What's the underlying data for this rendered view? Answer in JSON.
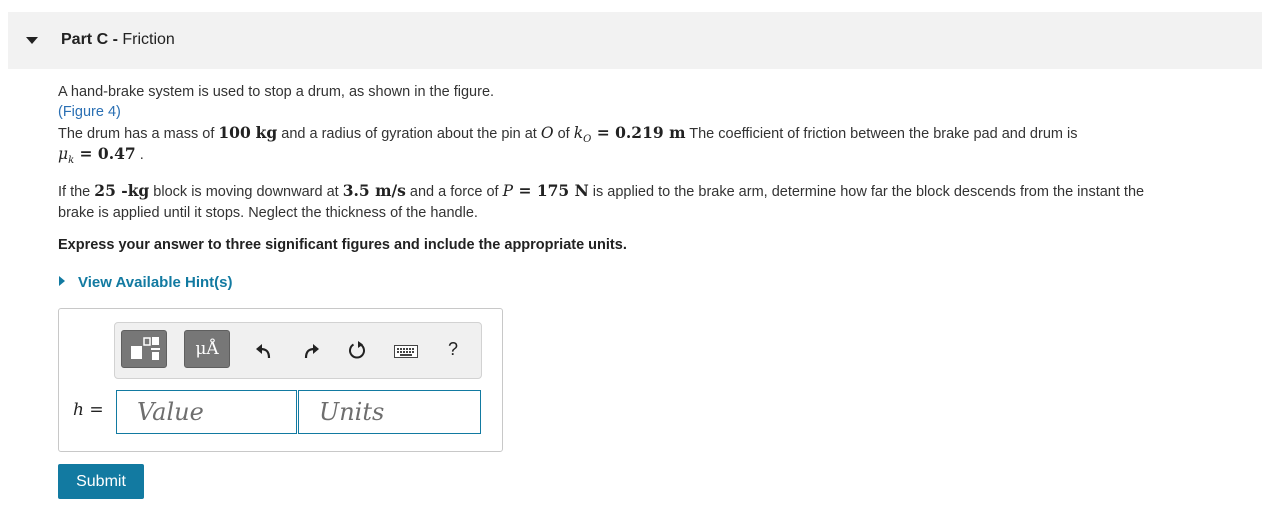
{
  "header": {
    "part_label": "Part C",
    "separator": " - ",
    "part_name": "Friction"
  },
  "problem": {
    "intro": "A hand-brake system is used to stop a drum, as shown in the figure.",
    "figure_link": "(Figure 4)",
    "line3_pre": "The drum has a mass of ",
    "mass_value": "100",
    "mass_unit": "kg",
    "line3_mid1": " and a radius of gyration about the pin at ",
    "point_o": "O",
    "line3_mid2": " of ",
    "k_sym": "k",
    "k_sub": "O",
    "k_eq": " = 0.219 ",
    "k_unit": "m",
    "line3_post": " The coefficient of friction between the brake pad and drum is",
    "mu_sym": "μ",
    "mu_sub": "k",
    "mu_eq": " = 0.47",
    "mu_post": " .",
    "line5_pre": "If the ",
    "block_mass": "25",
    "block_unit": " -kg",
    "line5_mid1": " block is moving downward at ",
    "speed_value": "3.5 ",
    "speed_unit": "m/s",
    "line5_mid2": " and a force of ",
    "p_sym": "P",
    "p_eq": " = 175 ",
    "p_unit": "N",
    "line5_post": " is applied to the brake arm, determine how far the block descends from the instant the",
    "line6": "brake is applied until it stops. Neglect the thickness of the handle.",
    "instruction": "Express your answer to three significant figures and include the appropriate units."
  },
  "hints": {
    "label": "View Available Hint(s)"
  },
  "toolbar": {
    "unit_button_label": "μÅ",
    "help_label": "?"
  },
  "answer": {
    "variable": "h",
    "equals": " =",
    "value_placeholder": "Value",
    "units_placeholder": "Units"
  },
  "submit_label": "Submit"
}
